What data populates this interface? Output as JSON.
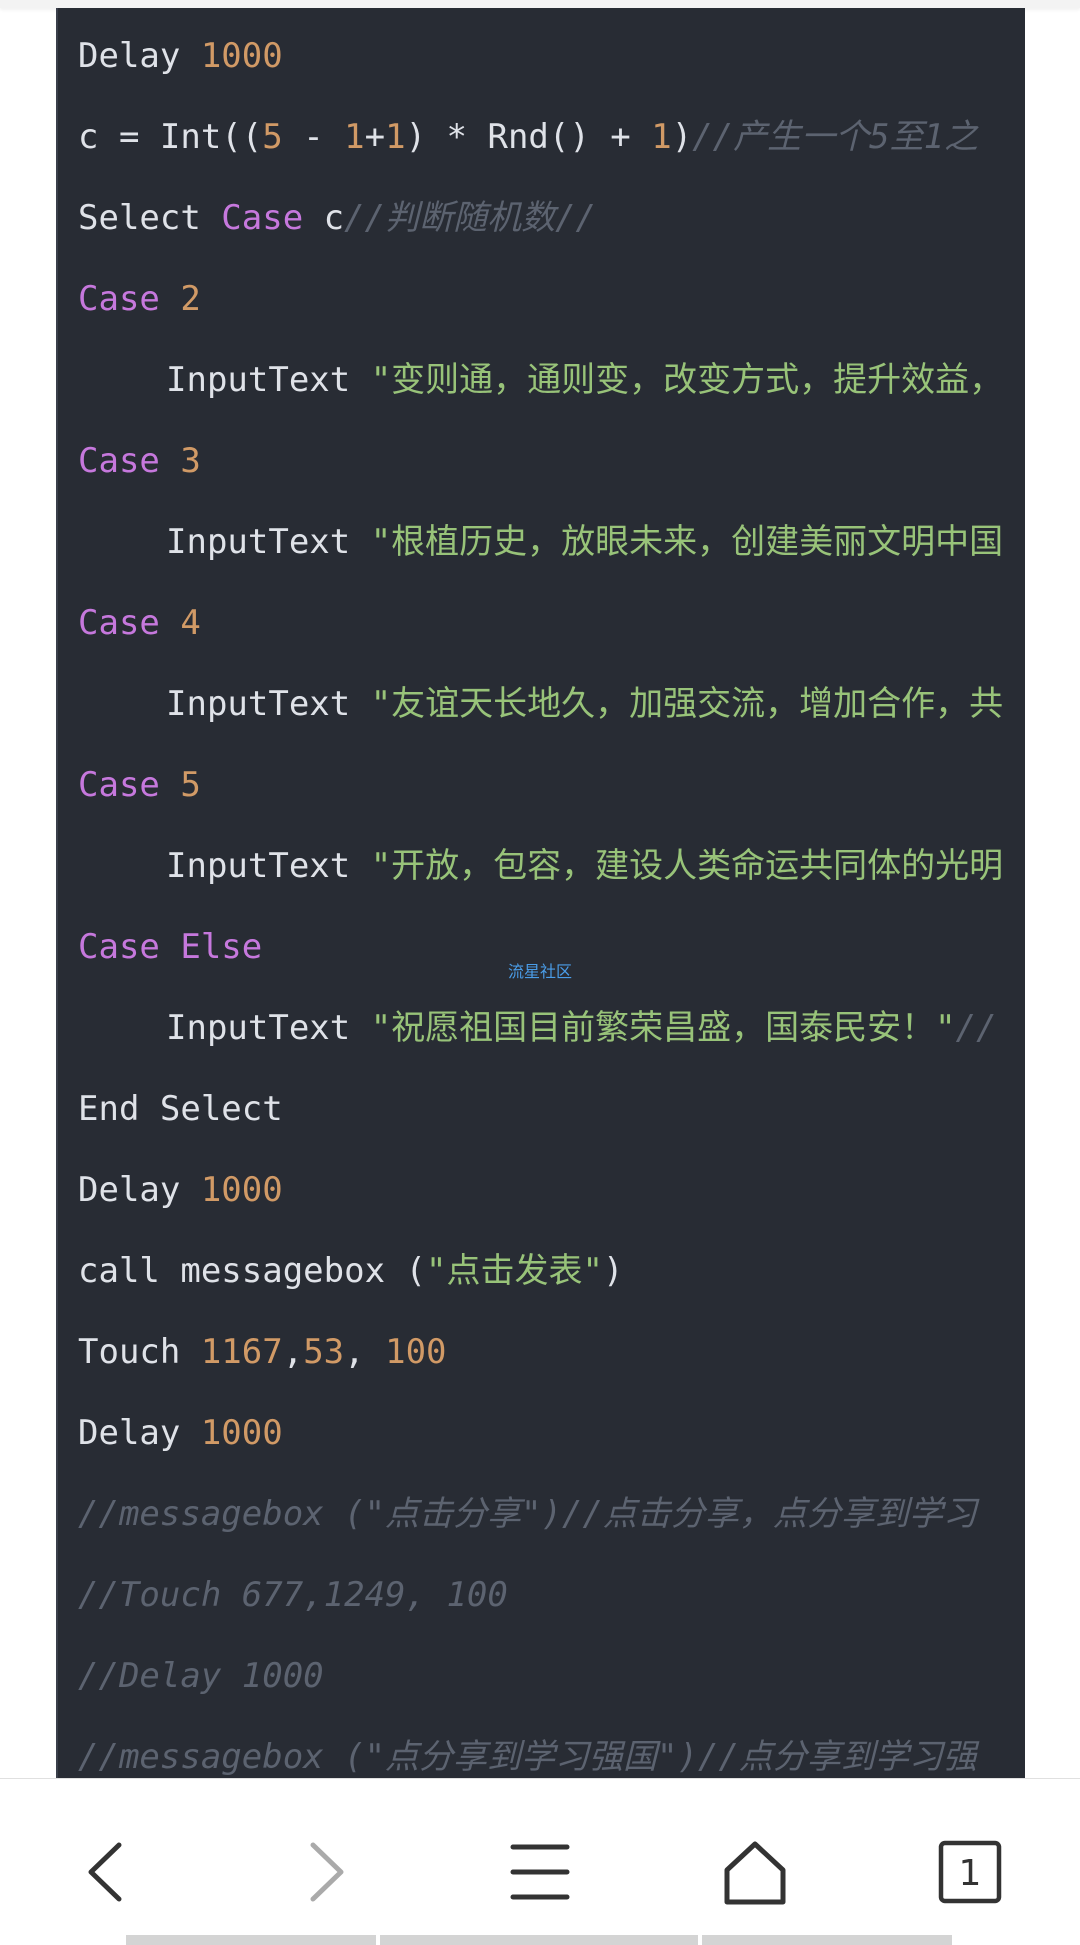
{
  "watermark": "流星社区",
  "code": {
    "lines": [
      {
        "tokens": [
          {
            "t": "Delay ",
            "c": "plain"
          },
          {
            "t": "1000",
            "c": "num"
          }
        ]
      },
      {
        "tokens": [
          {
            "t": "c = Int((",
            "c": "plain"
          },
          {
            "t": "5",
            "c": "num"
          },
          {
            "t": " - ",
            "c": "plain"
          },
          {
            "t": "1",
            "c": "num"
          },
          {
            "t": "+",
            "c": "plain"
          },
          {
            "t": "1",
            "c": "num"
          },
          {
            "t": ") * Rnd() + ",
            "c": "plain"
          },
          {
            "t": "1",
            "c": "num"
          },
          {
            "t": ")",
            "c": "plain"
          },
          {
            "t": "//产生一个5至1之",
            "c": "cm"
          }
        ]
      },
      {
        "tokens": [
          {
            "t": "Select ",
            "c": "plain"
          },
          {
            "t": "Case",
            "c": "kw"
          },
          {
            "t": " c",
            "c": "plain"
          },
          {
            "t": "//判断随机数//",
            "c": "cm"
          }
        ]
      },
      {
        "tokens": [
          {
            "t": "Case",
            "c": "kw"
          },
          {
            "t": " ",
            "c": "plain"
          },
          {
            "t": "2",
            "c": "num"
          }
        ]
      },
      {
        "indent": true,
        "tokens": [
          {
            "t": "InputText ",
            "c": "plain"
          },
          {
            "t": "\"变则通，通则变，改变方式，提升效益，",
            "c": "str"
          }
        ]
      },
      {
        "tokens": [
          {
            "t": "Case",
            "c": "kw"
          },
          {
            "t": " ",
            "c": "plain"
          },
          {
            "t": "3",
            "c": "num"
          }
        ]
      },
      {
        "indent": true,
        "tokens": [
          {
            "t": "InputText ",
            "c": "plain"
          },
          {
            "t": "\"根植历史，放眼未来，创建美丽文明中国",
            "c": "str"
          }
        ]
      },
      {
        "tokens": [
          {
            "t": "Case",
            "c": "kw"
          },
          {
            "t": " ",
            "c": "plain"
          },
          {
            "t": "4",
            "c": "num"
          }
        ]
      },
      {
        "indent": true,
        "tokens": [
          {
            "t": "InputText ",
            "c": "plain"
          },
          {
            "t": "\"友谊天长地久，加强交流，增加合作，共",
            "c": "str"
          }
        ]
      },
      {
        "tokens": [
          {
            "t": "Case",
            "c": "kw"
          },
          {
            "t": " ",
            "c": "plain"
          },
          {
            "t": "5",
            "c": "num"
          }
        ]
      },
      {
        "indent": true,
        "tokens": [
          {
            "t": "InputText ",
            "c": "plain"
          },
          {
            "t": "\"开放，包容，建设人类命运共同体的光明",
            "c": "str"
          }
        ]
      },
      {
        "tokens": [
          {
            "t": "Case Else",
            "c": "kw"
          }
        ]
      },
      {
        "indent": true,
        "tokens": [
          {
            "t": "InputText ",
            "c": "plain"
          },
          {
            "t": "\"祝愿祖国目前繁荣昌盛，国泰民安！\"",
            "c": "str"
          },
          {
            "t": "//",
            "c": "cm"
          }
        ]
      },
      {
        "tokens": [
          {
            "t": "End Select",
            "c": "plain"
          }
        ]
      },
      {
        "tokens": [
          {
            "t": "Delay ",
            "c": "plain"
          },
          {
            "t": "1000",
            "c": "num"
          }
        ]
      },
      {
        "tokens": [
          {
            "t": "call messagebox (",
            "c": "plain"
          },
          {
            "t": "\"点击发表\"",
            "c": "str"
          },
          {
            "t": ")",
            "c": "plain"
          }
        ]
      },
      {
        "tokens": [
          {
            "t": "Touch ",
            "c": "plain"
          },
          {
            "t": "1167",
            "c": "num"
          },
          {
            "t": ",",
            "c": "plain"
          },
          {
            "t": "53",
            "c": "num"
          },
          {
            "t": ", ",
            "c": "plain"
          },
          {
            "t": "100",
            "c": "num"
          }
        ]
      },
      {
        "tokens": [
          {
            "t": "Delay ",
            "c": "plain"
          },
          {
            "t": "1000",
            "c": "num"
          }
        ]
      },
      {
        "tokens": [
          {
            "t": "//messagebox (\"点击分享\")//点击分享，点分享到学习",
            "c": "cm"
          }
        ]
      },
      {
        "tokens": [
          {
            "t": "//Touch 677,1249, 100",
            "c": "cm"
          }
        ]
      },
      {
        "tokens": [
          {
            "t": "//Delay 1000",
            "c": "cm"
          }
        ]
      },
      {
        "tokens": [
          {
            "t": "//messagebox (\"点分享到学习强国\")//点分享到学习强",
            "c": "cm"
          }
        ]
      }
    ]
  },
  "nav": {
    "back_icon": "chevron-left-icon",
    "forward_icon": "chevron-right-icon",
    "menu_icon": "hamburger-menu-icon",
    "home_icon": "home-icon",
    "tabs_icon": "tabs-icon",
    "tab_count": "1"
  }
}
